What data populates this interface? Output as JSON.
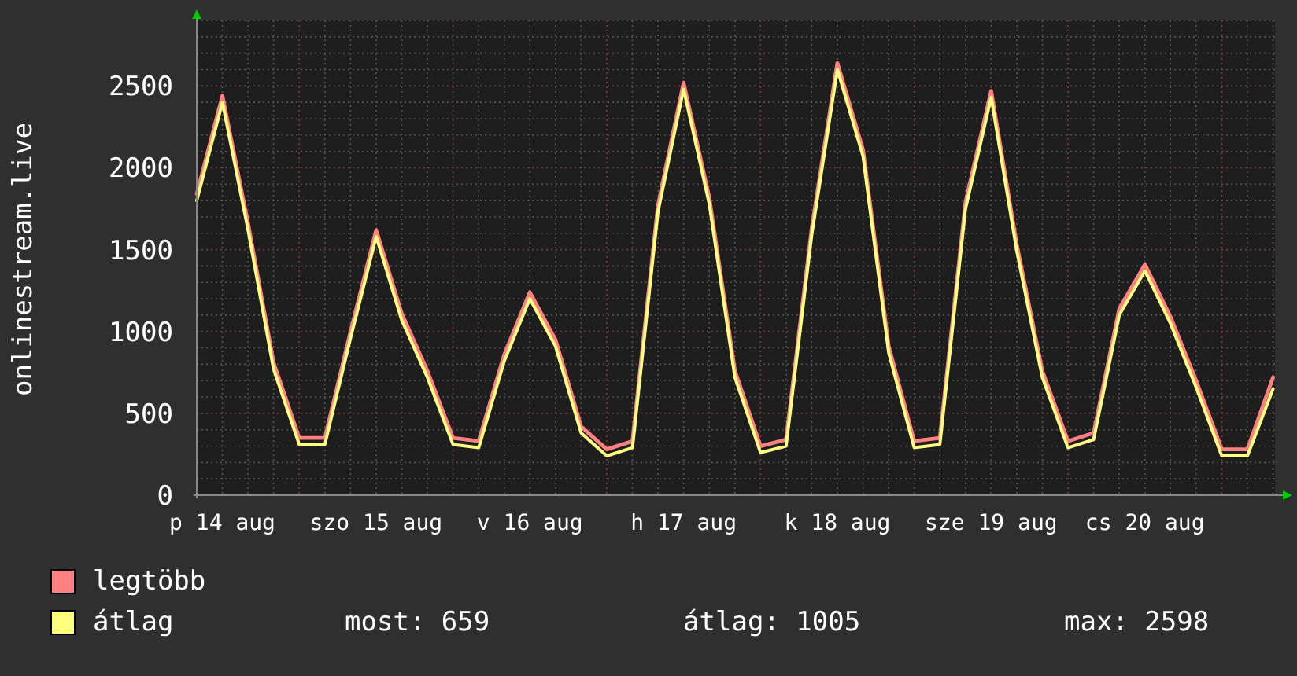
{
  "graph": {
    "chart_data": {
      "type": "line",
      "ylabel": "onlinestream.live",
      "categories": [
        null,
        "p 14 aug",
        null,
        null,
        null,
        null,
        null,
        "szo 15 aug",
        null,
        null,
        null,
        null,
        null,
        "v 16 aug",
        null,
        null,
        null,
        null,
        null,
        "h 17 aug",
        null,
        null,
        null,
        null,
        null,
        "k 18 aug",
        null,
        null,
        null,
        null,
        null,
        "sze 19 aug",
        null,
        null,
        null,
        null,
        null,
        "cs 20 aug",
        null,
        null,
        null,
        null,
        null
      ],
      "series": [
        {
          "name": "legtöbb",
          "color": "#ff8080",
          "values": [
            1840,
            2440,
            1660,
            810,
            350,
            350,
            1000,
            1620,
            1110,
            760,
            350,
            330,
            860,
            1240,
            950,
            420,
            280,
            330,
            1770,
            2520,
            1820,
            760,
            300,
            340,
            1630,
            2640,
            2110,
            910,
            330,
            350,
            1790,
            2470,
            1530,
            760,
            330,
            380,
            1140,
            1410,
            1090,
            700,
            280,
            280,
            720
          ]
        },
        {
          "name": "átlag",
          "color": "#ffff80",
          "values": [
            1800,
            2400,
            1620,
            770,
            310,
            310,
            960,
            1580,
            1070,
            720,
            310,
            290,
            820,
            1200,
            910,
            380,
            240,
            290,
            1730,
            2480,
            1780,
            720,
            260,
            300,
            1590,
            2600,
            2070,
            870,
            290,
            310,
            1750,
            2430,
            1490,
            720,
            290,
            340,
            1100,
            1370,
            1050,
            660,
            240,
            240,
            650
          ]
        }
      ],
      "grid": true,
      "ylim": [
        0,
        2900
      ],
      "yticks": [
        0,
        500,
        1000,
        1500,
        2000,
        2500
      ]
    }
  },
  "stats": [
    "most: 659",
    "átlag: 1005",
    "max: 2598"
  ]
}
